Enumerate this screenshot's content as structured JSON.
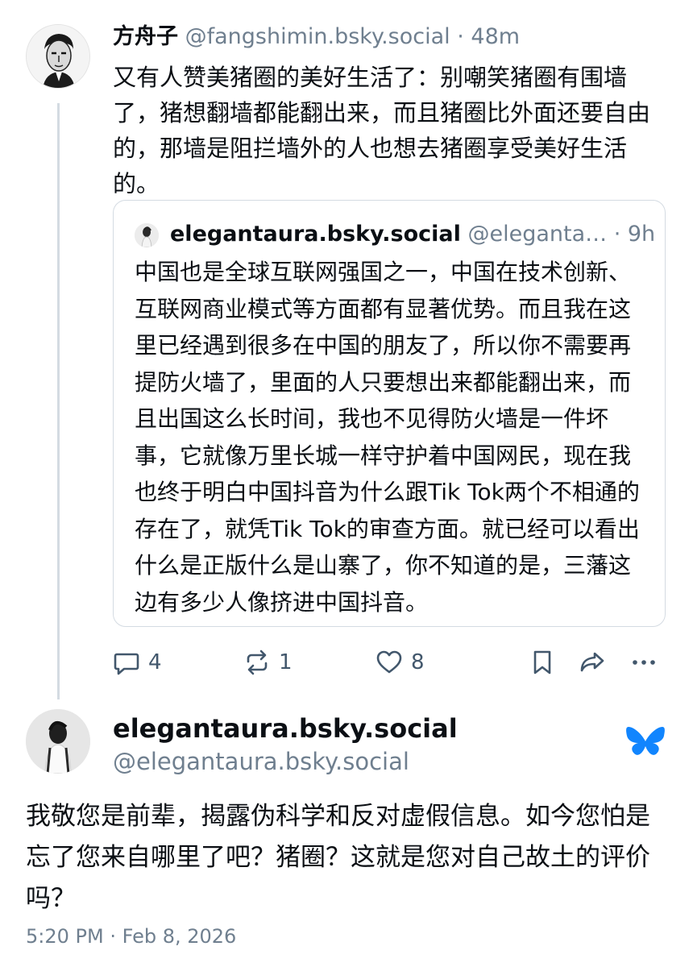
{
  "parent_post": {
    "display_name": "方舟子",
    "handle": "@fangshimin.bsky.social",
    "separator": " · ",
    "time_ago": "48m",
    "text": "又有人赞美猪圈的美好生活了：别嘲笑猪圈有围墙了，猪想翻墙都能翻出来，而且猪圈比外面还要自由的，那墙是阻拦墙外的人也想去猪圈享受美好生活的。",
    "quote": {
      "display_name": "elegantaura.bsky.social",
      "handle": "@eleganta…",
      "separator": " · ",
      "time_ago": "9h",
      "text": "中国也是全球互联网强国之一，中国在技术创新、互联网商业模式等方面都有显著优势。而且我在这里已经遇到很多在中国的朋友了，所以你不需要再提防火墙了，里面的人只要想出来都能翻出来，而且出国这么长时间，我也不见得防火墙是一件坏事，它就像万里长城一样守护着中国网民，现在我也终于明白中国抖音为什么跟Tik Tok两个不相通的存在了，就凭Tik Tok的审查方面。就已经可以看出什么是正版什么是山寨了，你不知道的是，三藩这边有多少人像挤进中国抖音。"
    },
    "actions": {
      "reply_count": "4",
      "repost_count": "1",
      "like_count": "8",
      "icons": [
        "reply-icon",
        "repost-icon",
        "like-icon",
        "bookmark-icon",
        "share-icon",
        "more-icon"
      ]
    }
  },
  "main_post": {
    "display_name": "elegantaura.bsky.social",
    "handle": "@elegantaura.bsky.social",
    "text": "我敬您是前辈，揭露伪科学和反对虚假信息。如今您怕是忘了您来自哪里了吧？猪圈？这就是您对自己故土的评价吗？",
    "timestamp": "5:20 PM · Feb 8, 2026"
  },
  "colors": {
    "text": "#0b0f14",
    "muted": "#6f7f8f",
    "border": "#d4dbe2",
    "icon": "#42576c",
    "brand_butterfly": "#1185fe"
  }
}
